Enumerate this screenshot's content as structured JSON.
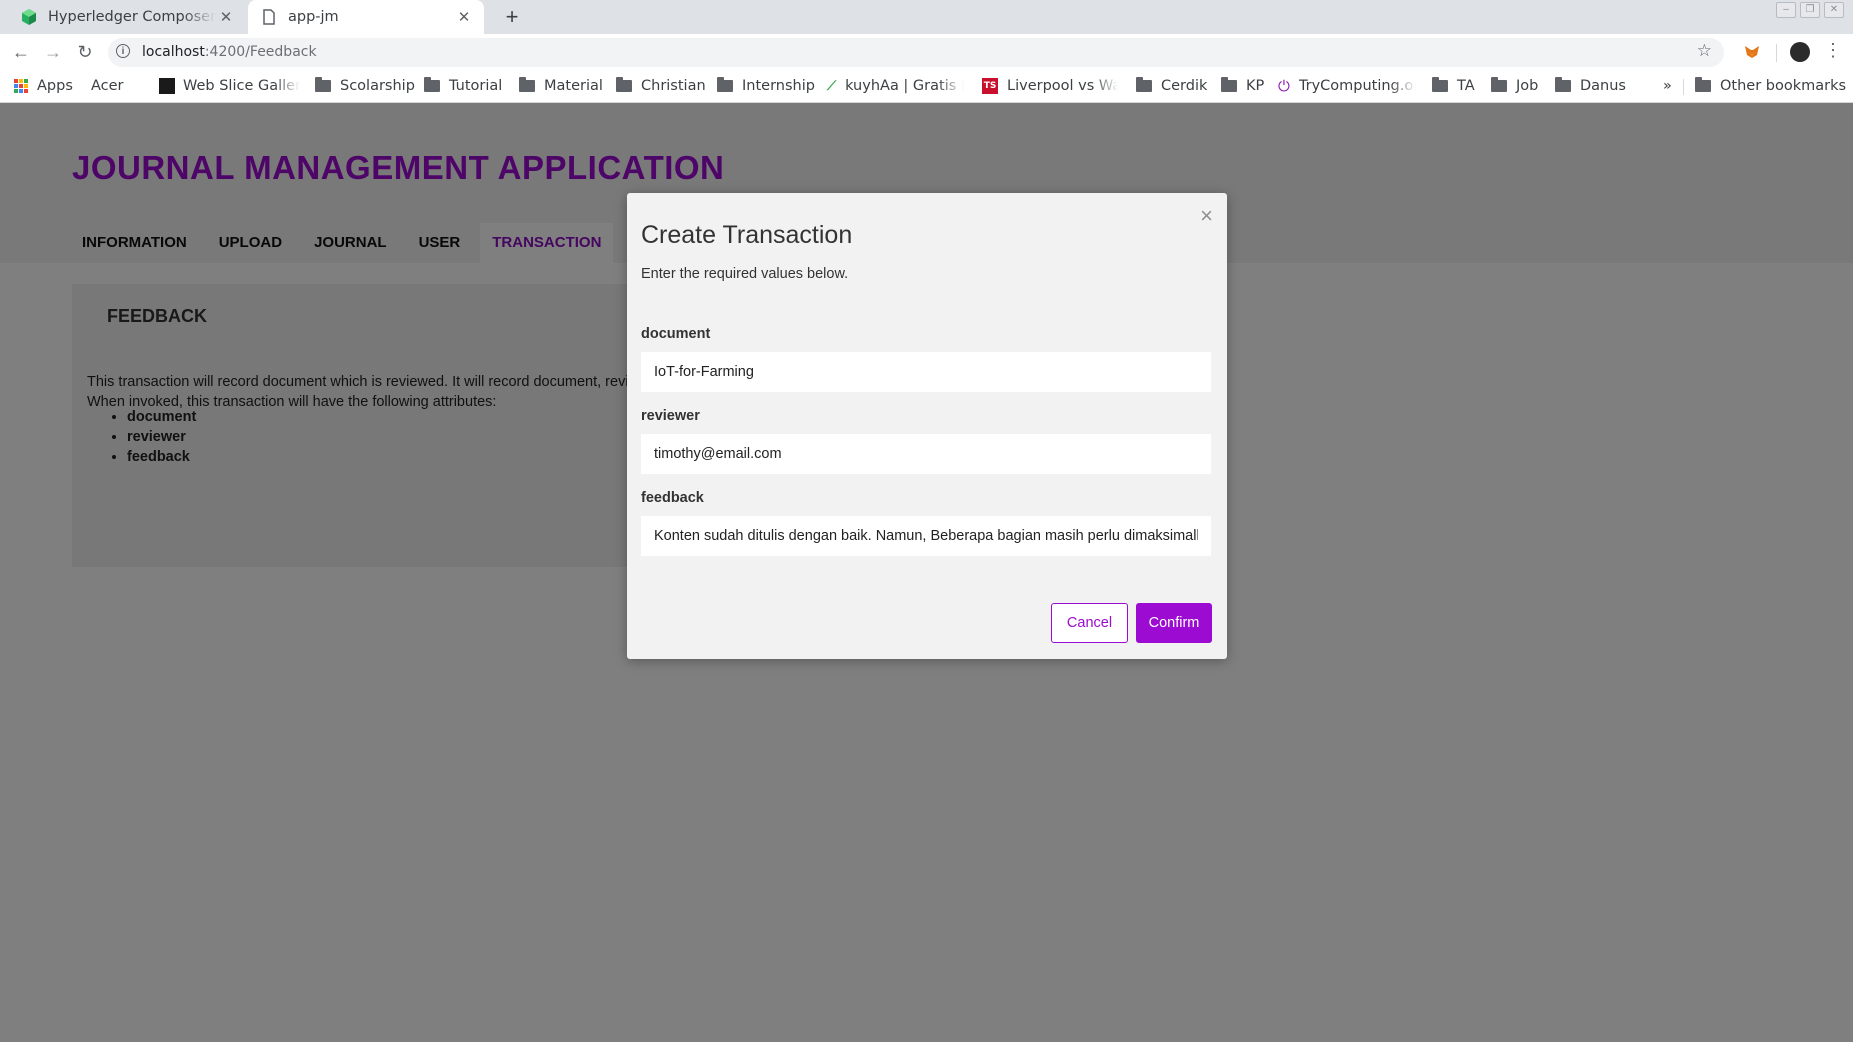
{
  "browser": {
    "tabs": [
      {
        "title": "Hyperledger Composer Rest Server",
        "active": false
      },
      {
        "title": "app-jm",
        "active": true
      }
    ],
    "url_host": "localhost",
    "url_path": ":4200/Feedback",
    "bookmarks": [
      {
        "label": "Apps",
        "kind": "apps"
      },
      {
        "label": "Acer",
        "kind": "page"
      },
      {
        "label": "Web Slice Gallery",
        "kind": "web-slice"
      },
      {
        "label": "Scolarship",
        "kind": "folder"
      },
      {
        "label": "Tutorial",
        "kind": "folder"
      },
      {
        "label": "Material",
        "kind": "folder"
      },
      {
        "label": "Christian",
        "kind": "folder"
      },
      {
        "label": "Internship",
        "kind": "folder"
      },
      {
        "label": "kuyhAa | Gratis Download",
        "kind": "kuyhaa"
      },
      {
        "label": "Liverpool vs Watford",
        "kind": "ts"
      },
      {
        "label": "Cerdik",
        "kind": "folder"
      },
      {
        "label": "KP",
        "kind": "folder"
      },
      {
        "label": "TryComputing.org",
        "kind": "power"
      },
      {
        "label": "TA",
        "kind": "folder"
      },
      {
        "label": "Job",
        "kind": "folder"
      },
      {
        "label": "Danus",
        "kind": "folder"
      }
    ],
    "more_label": "»",
    "other_bookmarks": "Other bookmarks"
  },
  "app": {
    "title": "JOURNAL MANAGEMENT APPLICATION",
    "nav": [
      {
        "label": "INFORMATION",
        "active": false
      },
      {
        "label": "UPLOAD",
        "active": false
      },
      {
        "label": "JOURNAL",
        "active": false
      },
      {
        "label": "USER",
        "active": false
      },
      {
        "label": "TRANSACTION",
        "active": true
      }
    ],
    "panel": {
      "heading": "FEEDBACK",
      "desc_line1": "This transaction will record document which is reviewed. It will record document, reviewer and feedback.",
      "desc_line2": "When invoked, this transaction will have the following attributes:",
      "attributes": [
        "document",
        "reviewer",
        "feedback"
      ]
    }
  },
  "modal": {
    "close": "×",
    "title": "Create Transaction",
    "subtitle": "Enter the required values below.",
    "fields": [
      {
        "label": "document",
        "value": "IoT-for-Farming"
      },
      {
        "label": "reviewer",
        "value": "timothy@email.com"
      },
      {
        "label": "feedback",
        "value": "Konten sudah ditulis dengan baik. Namun, Beberapa bagian masih perlu dimaksimalkan"
      }
    ],
    "cancel": "Cancel",
    "confirm": "Confirm"
  },
  "colors": {
    "accent": "#9b0bd1",
    "overlay": "rgba(0,0,0,0.5)"
  }
}
